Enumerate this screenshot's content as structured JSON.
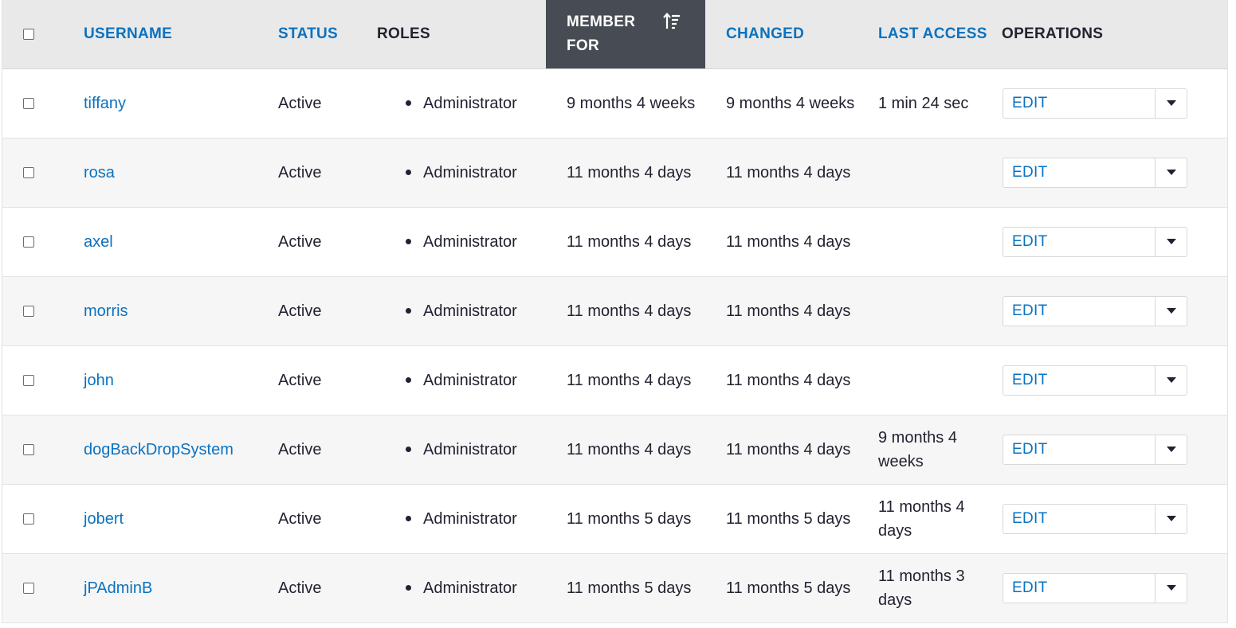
{
  "columns": {
    "username": "USERNAME",
    "status": "STATUS",
    "roles": "ROLES",
    "member_for_line1": "MEMBER",
    "member_for_line2": "FOR",
    "changed": "CHANGED",
    "last_access": "LAST ACCESS",
    "operations": "OPERATIONS"
  },
  "sort_icon": "sort-descending-icon",
  "colors": {
    "link": "#0a72c0",
    "header_bg": "#e9e9e9",
    "sorted_header_bg": "#474c54",
    "row_alt": "#f6f6f6"
  },
  "rows": [
    {
      "username": "tiffany",
      "status": "Active",
      "role": "Administrator",
      "member_for": "9 months 4 weeks",
      "changed": "9 months 4 weeks",
      "last_access": "1 min 24 sec",
      "op": "EDIT"
    },
    {
      "username": "rosa",
      "status": "Active",
      "role": "Administrator",
      "member_for": "11 months 4 days",
      "changed": "11 months 4 days",
      "last_access": "",
      "op": "EDIT"
    },
    {
      "username": "axel",
      "status": "Active",
      "role": "Administrator",
      "member_for": "11 months 4 days",
      "changed": "11 months 4 days",
      "last_access": "",
      "op": "EDIT"
    },
    {
      "username": "morris",
      "status": "Active",
      "role": "Administrator",
      "member_for": "11 months 4 days",
      "changed": "11 months 4 days",
      "last_access": "",
      "op": "EDIT"
    },
    {
      "username": "john",
      "status": "Active",
      "role": "Administrator",
      "member_for": "11 months 4 days",
      "changed": "11 months 4 days",
      "last_access": "",
      "op": "EDIT"
    },
    {
      "username": "dogBackDropSystem",
      "status": "Active",
      "role": "Administrator",
      "member_for": "11 months 4 days",
      "changed": "11 months 4 days",
      "last_access": "9 months 4 weeks",
      "op": "EDIT"
    },
    {
      "username": "jobert",
      "status": "Active",
      "role": "Administrator",
      "member_for": "11 months 5 days",
      "changed": "11 months 5 days",
      "last_access": "11 months 4 days",
      "op": "EDIT"
    },
    {
      "username": "jPAdminB",
      "status": "Active",
      "role": "Administrator",
      "member_for": "11 months 5 days",
      "changed": "11 months 5 days",
      "last_access": "11 months 3 days",
      "op": "EDIT"
    }
  ]
}
